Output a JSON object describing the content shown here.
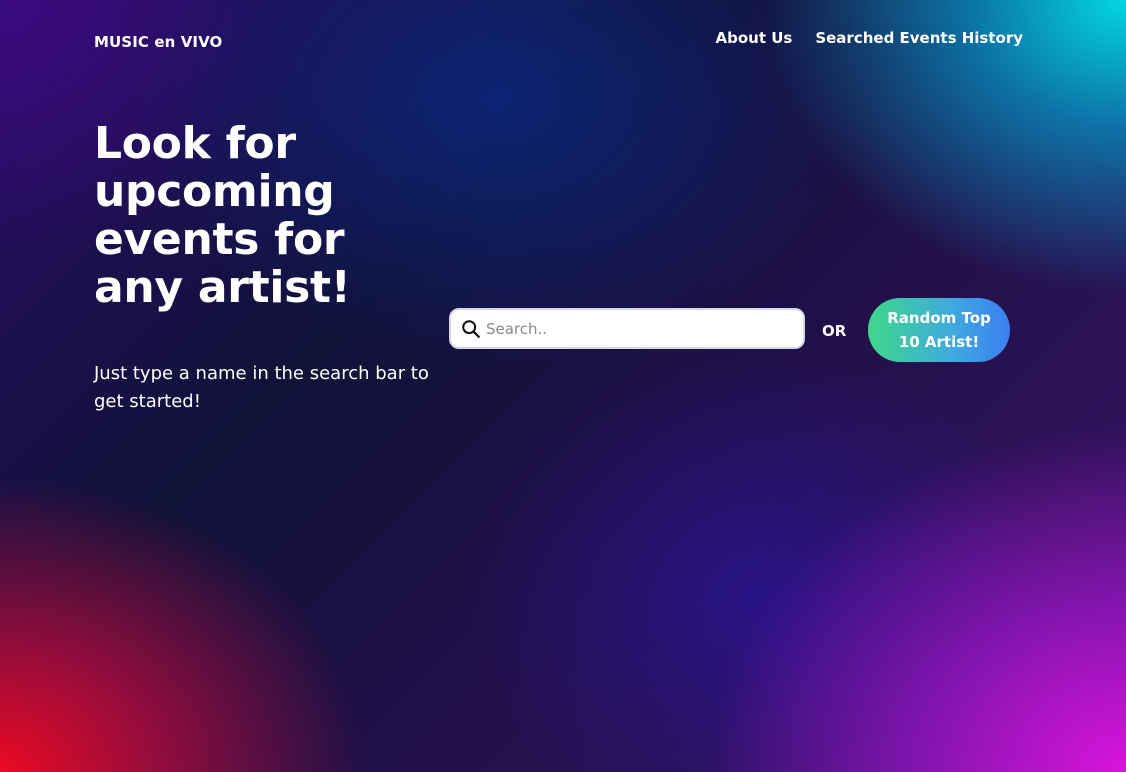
{
  "header": {
    "brand": "MUSIC en VIVO",
    "nav": [
      {
        "label": "About Us"
      },
      {
        "label": "Searched Events History"
      }
    ]
  },
  "hero": {
    "title": "Look for upcoming events for any artist!",
    "subtitle": "Just type a name in the search bar to get started!"
  },
  "search": {
    "icon": "search-icon",
    "placeholder": "Search..",
    "value": ""
  },
  "divider_text": "OR",
  "random_button": {
    "label": "Random Top 10 Artist!"
  },
  "colors": {
    "text": "#ffffff",
    "button_gradient_start": "#3ed88a",
    "button_gradient_end": "#3b7ff0",
    "background_top_right": "#00e1eb",
    "background_bottom_right": "#e114e1",
    "background_bottom_left": "#eb0a23"
  }
}
